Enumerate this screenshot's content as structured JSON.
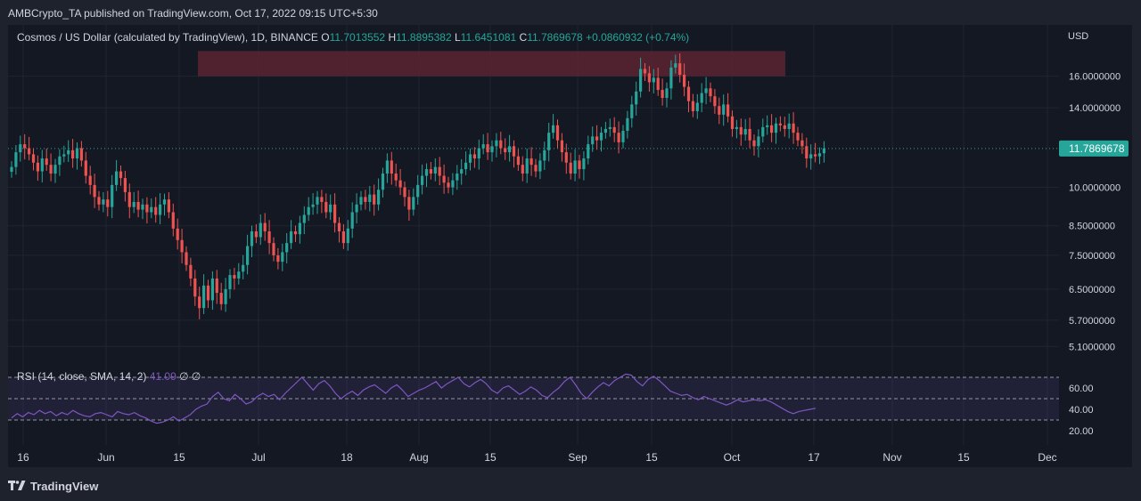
{
  "header": {
    "published_text": "AMBCrypto_TA published on TradingView.com, Oct 17, 2022 09:15 UTC+5:30"
  },
  "legend": {
    "symbol": "Cosmos / US Dollar (calculated by TradingView), 1D, BINANCE",
    "o_label": "O",
    "o_value": "11.7013552",
    "h_label": "H",
    "h_value": "11.8895382",
    "l_label": "L",
    "l_value": "11.6451081",
    "c_label": "C",
    "c_value": "11.7869678",
    "change": "+0.0860932 (+0.74%)"
  },
  "rsi_legend": {
    "label": "RSI (14, close, SMA, 14, 2)",
    "value": "41.09",
    "extra1": "∅",
    "extra2": "∅"
  },
  "price_axis": {
    "currency": "USD",
    "current_price_label": "11.7869678"
  },
  "footer": {
    "brand": "TradingView"
  },
  "colors": {
    "up": "#26a69a",
    "down": "#ef5350",
    "rsi_line": "#7e57c2",
    "resistance_zone": "#5a2431",
    "background": "#141823"
  },
  "chart_data": [
    {
      "type": "candlestick",
      "title": "Cosmos / US Dollar (calculated by TradingView), 1D, BINANCE",
      "y_scale": "log",
      "ylim": [
        4.9,
        18.3
      ],
      "y_ticks": [
        "16.0000000",
        "14.0000000",
        "10.0000000",
        "8.5000000",
        "7.5000000",
        "6.5000000",
        "5.7000000",
        "5.1000000"
      ],
      "x_ticks": [
        "16",
        "Jun",
        "15",
        "Jul",
        "18",
        "Aug",
        "15",
        "Sep",
        "15",
        "Oct",
        "17",
        "Nov",
        "15",
        "Dec"
      ],
      "resistance_zone": [
        16.0,
        17.8
      ],
      "last_price": 11.7869678,
      "close": [
        10.9,
        11.6,
        12.0,
        11.8,
        11.5,
        11.1,
        10.7,
        11.3,
        11.0,
        10.6,
        11.0,
        11.4,
        11.5,
        11.7,
        11.3,
        11.8,
        11.2,
        10.5,
        10.1,
        9.6,
        9.3,
        9.5,
        9.2,
        10.1,
        10.7,
        10.4,
        9.8,
        9.2,
        9.4,
        9.1,
        9.3,
        9.0,
        9.2,
        8.9,
        9.3,
        9.5,
        9.0,
        8.4,
        8.0,
        7.6,
        7.2,
        6.8,
        6.3,
        6.0,
        6.6,
        6.2,
        6.8,
        6.4,
        6.1,
        6.5,
        6.9,
        6.8,
        7.0,
        7.2,
        7.8,
        8.3,
        8.1,
        8.6,
        8.3,
        7.9,
        7.5,
        7.3,
        7.6,
        7.9,
        8.3,
        8.2,
        8.6,
        8.9,
        9.2,
        9.3,
        9.6,
        9.4,
        9.0,
        9.3,
        8.6,
        8.3,
        7.9,
        8.4,
        9.0,
        9.3,
        9.6,
        9.4,
        9.7,
        9.3,
        9.9,
        10.6,
        11.2,
        10.6,
        10.3,
        10.0,
        9.6,
        9.1,
        9.6,
        10.1,
        10.5,
        10.8,
        10.6,
        10.9,
        10.5,
        10.2,
        10.0,
        10.3,
        10.6,
        10.8,
        11.1,
        11.5,
        11.3,
        11.8,
        12.0,
        11.6,
        11.9,
        12.2,
        11.8,
        11.6,
        11.9,
        11.4,
        11.0,
        10.6,
        11.3,
        11.0,
        10.7,
        11.2,
        11.7,
        12.6,
        13.0,
        12.2,
        11.6,
        11.1,
        10.6,
        11.2,
        10.8,
        11.3,
        12.0,
        12.4,
        12.2,
        12.6,
        12.8,
        12.9,
        12.6,
        12.1,
        12.7,
        13.4,
        14.2,
        15.0,
        16.5,
        16.2,
        15.6,
        15.9,
        15.1,
        14.6,
        15.2,
        16.6,
        16.9,
        16.1,
        15.3,
        14.4,
        13.8,
        14.3,
        14.9,
        15.2,
        14.7,
        14.1,
        13.6,
        14.2,
        13.5,
        12.8,
        12.9,
        12.5,
        12.8,
        12.2,
        11.9,
        12.4,
        12.9,
        13.0,
        12.6,
        13.1,
        13.0,
        12.8,
        13.1,
        12.6,
        12.2,
        11.9,
        11.3,
        11.5,
        11.4,
        11.55,
        11.79
      ]
    },
    {
      "type": "line",
      "title": "RSI (14, close, SMA, 14, 2)",
      "ylim": [
        20,
        75
      ],
      "y_ticks": [
        "60.00",
        "40.00",
        "20.00"
      ],
      "bands": [
        30,
        50,
        70
      ],
      "series": [
        {
          "name": "RSI",
          "values": [
            32,
            36,
            33,
            37,
            35,
            39,
            36,
            38,
            34,
            37,
            35,
            39,
            36,
            34,
            33,
            36,
            37,
            35,
            33,
            38,
            36,
            35,
            37,
            34,
            32,
            29,
            27,
            28,
            30,
            33,
            29,
            32,
            35,
            40,
            43,
            45,
            52,
            56,
            50,
            48,
            54,
            50,
            45,
            47,
            52,
            55,
            52,
            54,
            49,
            55,
            60,
            65,
            70,
            64,
            58,
            64,
            67,
            62,
            55,
            50,
            54,
            57,
            53,
            58,
            61,
            63,
            59,
            55,
            60,
            63,
            58,
            52,
            55,
            58,
            60,
            63,
            66,
            60,
            64,
            67,
            70,
            64,
            61,
            65,
            68,
            64,
            58,
            55,
            60,
            62,
            58,
            54,
            57,
            61,
            58,
            53,
            51,
            56,
            60,
            66,
            70,
            63,
            55,
            50,
            56,
            61,
            65,
            62,
            67,
            70,
            73,
            72,
            66,
            62,
            68,
            71,
            67,
            62,
            57,
            55,
            53,
            54,
            51,
            49,
            52,
            50,
            48,
            46,
            44,
            46,
            49,
            47,
            48,
            49,
            48,
            49,
            47,
            44,
            41,
            38,
            36,
            38,
            39,
            40,
            41
          ]
        }
      ]
    }
  ]
}
